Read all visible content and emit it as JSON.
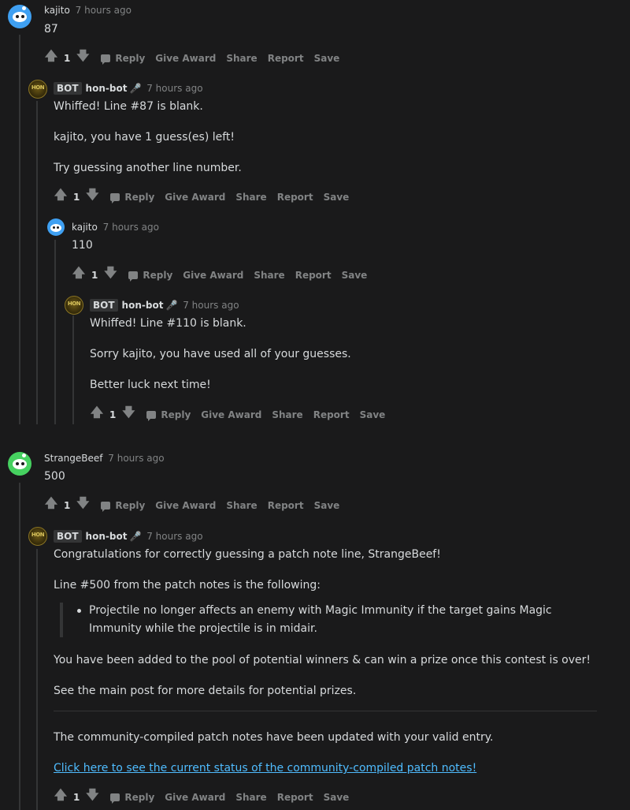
{
  "comments": {
    "c1": {
      "author": "kajito",
      "time": "7 hours ago",
      "body": "87",
      "score": "1"
    },
    "c2": {
      "badge": "BOT",
      "author": "hon-bot",
      "time": "7 hours ago",
      "lines": [
        "Whiffed! Line #87 is blank.",
        "kajito, you have 1 guess(es) left!",
        "Try guessing another line number."
      ],
      "score": "1"
    },
    "c3": {
      "author": "kajito",
      "time": "7 hours ago",
      "body": "110",
      "score": "1"
    },
    "c4": {
      "badge": "BOT",
      "author": "hon-bot",
      "time": "7 hours ago",
      "lines": [
        "Whiffed! Line #110 is blank.",
        "Sorry kajito, you have used all of your guesses.",
        "Better luck next time!"
      ],
      "score": "1"
    },
    "c5": {
      "author": "StrangeBeef",
      "time": "7 hours ago",
      "body": "500",
      "score": "1"
    },
    "c6": {
      "badge": "BOT",
      "author": "hon-bot",
      "time": "7 hours ago",
      "lines": [
        "Congratulations for correctly guessing a patch note line, StrangeBeef!",
        "Line #500 from the patch notes is the following:",
        "You have been added to the pool of potential winners & can win a prize once this contest is over!",
        "See the main post for more details for potential prizes.",
        "The community-compiled patch notes have been updated with your valid entry."
      ],
      "quote_lines": [
        "Projectile no longer affects an enemy with Magic Immunity if the target gains Magic",
        "Immunity while the projectile is in midair."
      ],
      "link": "Click here to see the current status of the community-compiled patch notes!",
      "score": "1"
    }
  },
  "actions": {
    "reply": "Reply",
    "give_award": "Give Award",
    "share": "Share",
    "report": "Report",
    "save": "Save"
  },
  "bot_avatar_text": "HON",
  "colors": {
    "background": "#1a1a1b",
    "text": "#d7dadc",
    "muted": "#818384",
    "link": "#4fbcff",
    "avatar_blue": "#3fa0f2",
    "avatar_green": "#46d160"
  }
}
